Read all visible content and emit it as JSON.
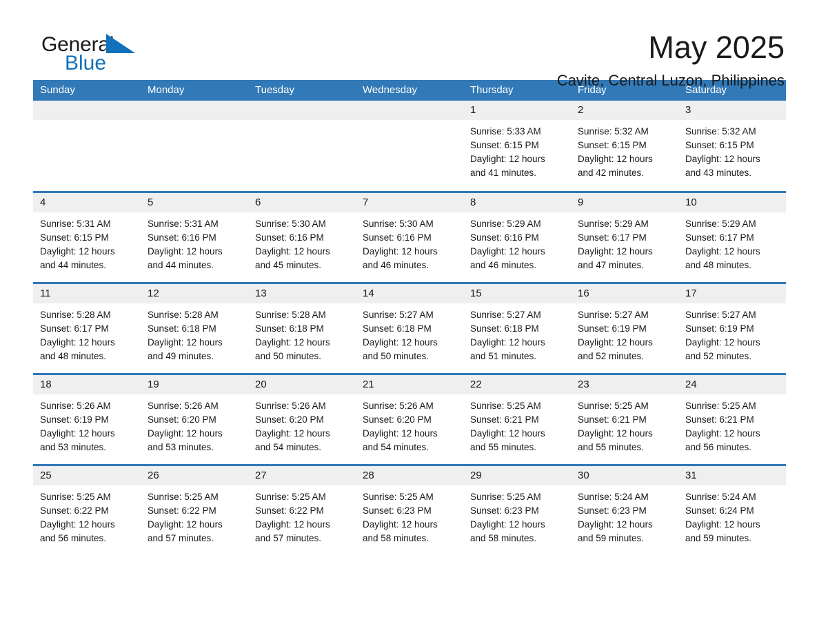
{
  "brand": {
    "name_part1": "General",
    "name_part2": "Blue",
    "accent_color": "#1271bb"
  },
  "header": {
    "month_title": "May 2025",
    "location": "Cavite, Central Luzon, Philippines",
    "header_bg_color": "#3279b7",
    "daynum_bg_color": "#efefef"
  },
  "weekday_headers": [
    "Sunday",
    "Monday",
    "Tuesday",
    "Wednesday",
    "Thursday",
    "Friday",
    "Saturday"
  ],
  "weeks": [
    [
      {
        "day": "",
        "sunrise": "",
        "sunset": "",
        "daylight_line1": "",
        "daylight_line2": ""
      },
      {
        "day": "",
        "sunrise": "",
        "sunset": "",
        "daylight_line1": "",
        "daylight_line2": ""
      },
      {
        "day": "",
        "sunrise": "",
        "sunset": "",
        "daylight_line1": "",
        "daylight_line2": ""
      },
      {
        "day": "",
        "sunrise": "",
        "sunset": "",
        "daylight_line1": "",
        "daylight_line2": ""
      },
      {
        "day": "1",
        "sunrise": "Sunrise: 5:33 AM",
        "sunset": "Sunset: 6:15 PM",
        "daylight_line1": "Daylight: 12 hours",
        "daylight_line2": "and 41 minutes."
      },
      {
        "day": "2",
        "sunrise": "Sunrise: 5:32 AM",
        "sunset": "Sunset: 6:15 PM",
        "daylight_line1": "Daylight: 12 hours",
        "daylight_line2": "and 42 minutes."
      },
      {
        "day": "3",
        "sunrise": "Sunrise: 5:32 AM",
        "sunset": "Sunset: 6:15 PM",
        "daylight_line1": "Daylight: 12 hours",
        "daylight_line2": "and 43 minutes."
      }
    ],
    [
      {
        "day": "4",
        "sunrise": "Sunrise: 5:31 AM",
        "sunset": "Sunset: 6:15 PM",
        "daylight_line1": "Daylight: 12 hours",
        "daylight_line2": "and 44 minutes."
      },
      {
        "day": "5",
        "sunrise": "Sunrise: 5:31 AM",
        "sunset": "Sunset: 6:16 PM",
        "daylight_line1": "Daylight: 12 hours",
        "daylight_line2": "and 44 minutes."
      },
      {
        "day": "6",
        "sunrise": "Sunrise: 5:30 AM",
        "sunset": "Sunset: 6:16 PM",
        "daylight_line1": "Daylight: 12 hours",
        "daylight_line2": "and 45 minutes."
      },
      {
        "day": "7",
        "sunrise": "Sunrise: 5:30 AM",
        "sunset": "Sunset: 6:16 PM",
        "daylight_line1": "Daylight: 12 hours",
        "daylight_line2": "and 46 minutes."
      },
      {
        "day": "8",
        "sunrise": "Sunrise: 5:29 AM",
        "sunset": "Sunset: 6:16 PM",
        "daylight_line1": "Daylight: 12 hours",
        "daylight_line2": "and 46 minutes."
      },
      {
        "day": "9",
        "sunrise": "Sunrise: 5:29 AM",
        "sunset": "Sunset: 6:17 PM",
        "daylight_line1": "Daylight: 12 hours",
        "daylight_line2": "and 47 minutes."
      },
      {
        "day": "10",
        "sunrise": "Sunrise: 5:29 AM",
        "sunset": "Sunset: 6:17 PM",
        "daylight_line1": "Daylight: 12 hours",
        "daylight_line2": "and 48 minutes."
      }
    ],
    [
      {
        "day": "11",
        "sunrise": "Sunrise: 5:28 AM",
        "sunset": "Sunset: 6:17 PM",
        "daylight_line1": "Daylight: 12 hours",
        "daylight_line2": "and 48 minutes."
      },
      {
        "day": "12",
        "sunrise": "Sunrise: 5:28 AM",
        "sunset": "Sunset: 6:18 PM",
        "daylight_line1": "Daylight: 12 hours",
        "daylight_line2": "and 49 minutes."
      },
      {
        "day": "13",
        "sunrise": "Sunrise: 5:28 AM",
        "sunset": "Sunset: 6:18 PM",
        "daylight_line1": "Daylight: 12 hours",
        "daylight_line2": "and 50 minutes."
      },
      {
        "day": "14",
        "sunrise": "Sunrise: 5:27 AM",
        "sunset": "Sunset: 6:18 PM",
        "daylight_line1": "Daylight: 12 hours",
        "daylight_line2": "and 50 minutes."
      },
      {
        "day": "15",
        "sunrise": "Sunrise: 5:27 AM",
        "sunset": "Sunset: 6:18 PM",
        "daylight_line1": "Daylight: 12 hours",
        "daylight_line2": "and 51 minutes."
      },
      {
        "day": "16",
        "sunrise": "Sunrise: 5:27 AM",
        "sunset": "Sunset: 6:19 PM",
        "daylight_line1": "Daylight: 12 hours",
        "daylight_line2": "and 52 minutes."
      },
      {
        "day": "17",
        "sunrise": "Sunrise: 5:27 AM",
        "sunset": "Sunset: 6:19 PM",
        "daylight_line1": "Daylight: 12 hours",
        "daylight_line2": "and 52 minutes."
      }
    ],
    [
      {
        "day": "18",
        "sunrise": "Sunrise: 5:26 AM",
        "sunset": "Sunset: 6:19 PM",
        "daylight_line1": "Daylight: 12 hours",
        "daylight_line2": "and 53 minutes."
      },
      {
        "day": "19",
        "sunrise": "Sunrise: 5:26 AM",
        "sunset": "Sunset: 6:20 PM",
        "daylight_line1": "Daylight: 12 hours",
        "daylight_line2": "and 53 minutes."
      },
      {
        "day": "20",
        "sunrise": "Sunrise: 5:26 AM",
        "sunset": "Sunset: 6:20 PM",
        "daylight_line1": "Daylight: 12 hours",
        "daylight_line2": "and 54 minutes."
      },
      {
        "day": "21",
        "sunrise": "Sunrise: 5:26 AM",
        "sunset": "Sunset: 6:20 PM",
        "daylight_line1": "Daylight: 12 hours",
        "daylight_line2": "and 54 minutes."
      },
      {
        "day": "22",
        "sunrise": "Sunrise: 5:25 AM",
        "sunset": "Sunset: 6:21 PM",
        "daylight_line1": "Daylight: 12 hours",
        "daylight_line2": "and 55 minutes."
      },
      {
        "day": "23",
        "sunrise": "Sunrise: 5:25 AM",
        "sunset": "Sunset: 6:21 PM",
        "daylight_line1": "Daylight: 12 hours",
        "daylight_line2": "and 55 minutes."
      },
      {
        "day": "24",
        "sunrise": "Sunrise: 5:25 AM",
        "sunset": "Sunset: 6:21 PM",
        "daylight_line1": "Daylight: 12 hours",
        "daylight_line2": "and 56 minutes."
      }
    ],
    [
      {
        "day": "25",
        "sunrise": "Sunrise: 5:25 AM",
        "sunset": "Sunset: 6:22 PM",
        "daylight_line1": "Daylight: 12 hours",
        "daylight_line2": "and 56 minutes."
      },
      {
        "day": "26",
        "sunrise": "Sunrise: 5:25 AM",
        "sunset": "Sunset: 6:22 PM",
        "daylight_line1": "Daylight: 12 hours",
        "daylight_line2": "and 57 minutes."
      },
      {
        "day": "27",
        "sunrise": "Sunrise: 5:25 AM",
        "sunset": "Sunset: 6:22 PM",
        "daylight_line1": "Daylight: 12 hours",
        "daylight_line2": "and 57 minutes."
      },
      {
        "day": "28",
        "sunrise": "Sunrise: 5:25 AM",
        "sunset": "Sunset: 6:23 PM",
        "daylight_line1": "Daylight: 12 hours",
        "daylight_line2": "and 58 minutes."
      },
      {
        "day": "29",
        "sunrise": "Sunrise: 5:25 AM",
        "sunset": "Sunset: 6:23 PM",
        "daylight_line1": "Daylight: 12 hours",
        "daylight_line2": "and 58 minutes."
      },
      {
        "day": "30",
        "sunrise": "Sunrise: 5:24 AM",
        "sunset": "Sunset: 6:23 PM",
        "daylight_line1": "Daylight: 12 hours",
        "daylight_line2": "and 59 minutes."
      },
      {
        "day": "31",
        "sunrise": "Sunrise: 5:24 AM",
        "sunset": "Sunset: 6:24 PM",
        "daylight_line1": "Daylight: 12 hours",
        "daylight_line2": "and 59 minutes."
      }
    ]
  ]
}
